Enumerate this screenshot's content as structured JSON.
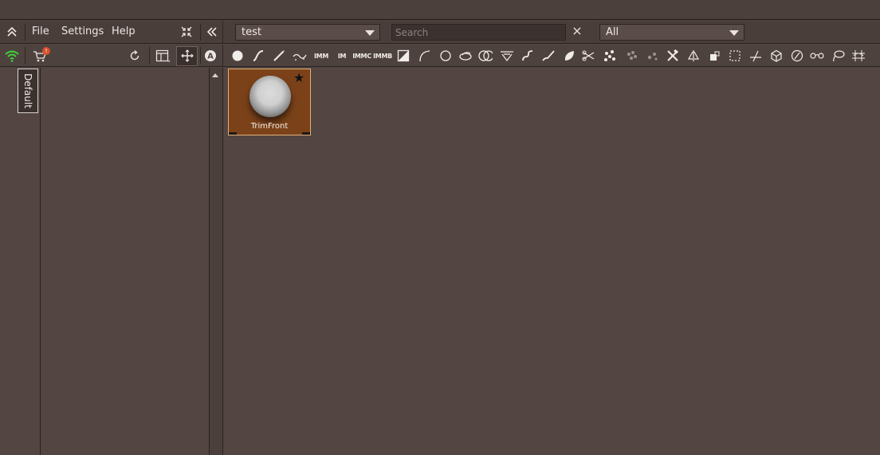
{
  "menubar": {
    "items": [
      "File",
      "Settings",
      "Help"
    ],
    "library_select": "test",
    "search_placeholder": "Search",
    "filter_select": "All",
    "clear_symbol": "×"
  },
  "toolbar": {
    "notification_count": "!",
    "left_tools": [
      "wifi-icon",
      "cart-icon",
      "refresh-icon",
      "layout-icon",
      "move-icon",
      "a-circle-icon"
    ],
    "brush_tools": [
      "sphere-icon",
      "curve-icon",
      "brush-icon",
      "stroke-icon",
      "IMM",
      "IM",
      "IMMC",
      "IMMB",
      "mask-rect-icon",
      "arc-icon",
      "circle-icon",
      "clay-icon",
      "rings-icon",
      "pinch-icon",
      "step-icon",
      "paint-brush-icon",
      "leaf-icon",
      "scissors-icon",
      "scatter-icon",
      "dots-icon",
      "dots-small-icon",
      "tools-icon",
      "mirror-icon",
      "blocks-icon",
      "select-rect-icon",
      "slice-icon",
      "cube-icon",
      "circle-slash-icon",
      "chain-icon",
      "lasso-icon",
      "grid-snake-icon"
    ]
  },
  "sidebar": {
    "tab_label": "Default"
  },
  "items": [
    {
      "label": "TrimFront",
      "favorite": true,
      "thumbnail": "sphere"
    }
  ],
  "colors": {
    "background": "#524542",
    "tile": "#7b4219",
    "tile_border": "#e2b077",
    "wifi": "#3fd23a",
    "badge": "#d9502b"
  }
}
